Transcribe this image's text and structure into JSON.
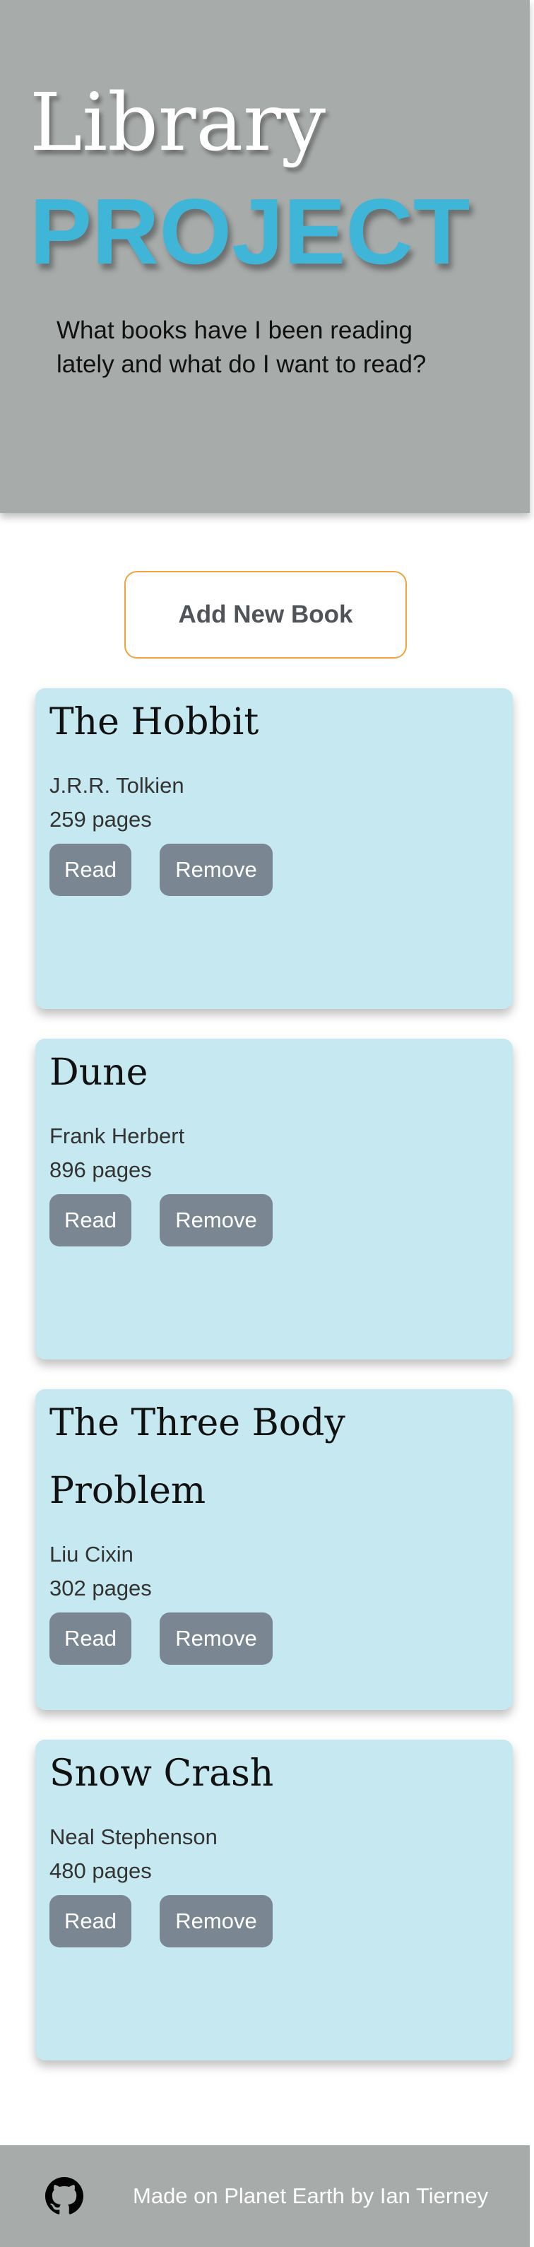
{
  "header": {
    "title_line1": "Library",
    "title_line2": "PROJECT",
    "subtitle": "What books have I been reading lately and what do I want to read?"
  },
  "actions": {
    "add_label": "Add New Book"
  },
  "books": [
    {
      "title": "The Hobbit",
      "author": "J.R.R. Tolkien",
      "pages": "259 pages",
      "read_label": "Read",
      "remove_label": "Remove"
    },
    {
      "title": "Dune",
      "author": "Frank Herbert",
      "pages": "896 pages",
      "read_label": "Read",
      "remove_label": "Remove"
    },
    {
      "title": "The Three Body Problem",
      "author": "Liu Cixin",
      "pages": "302 pages",
      "read_label": "Read",
      "remove_label": "Remove"
    },
    {
      "title": "Snow Crash",
      "author": "Neal Stephenson",
      "pages": "480 pages",
      "read_label": "Read",
      "remove_label": "Remove"
    }
  ],
  "footer": {
    "icon": "github-icon",
    "text": "Made on Planet Earth by Ian Tierney"
  },
  "colors": {
    "header_bg": "#a7aba9",
    "accent_blue": "#3fb6d8",
    "card_bg": "#c6e8f1",
    "button_bg": "#7a8792",
    "add_border": "#f2a33a"
  }
}
